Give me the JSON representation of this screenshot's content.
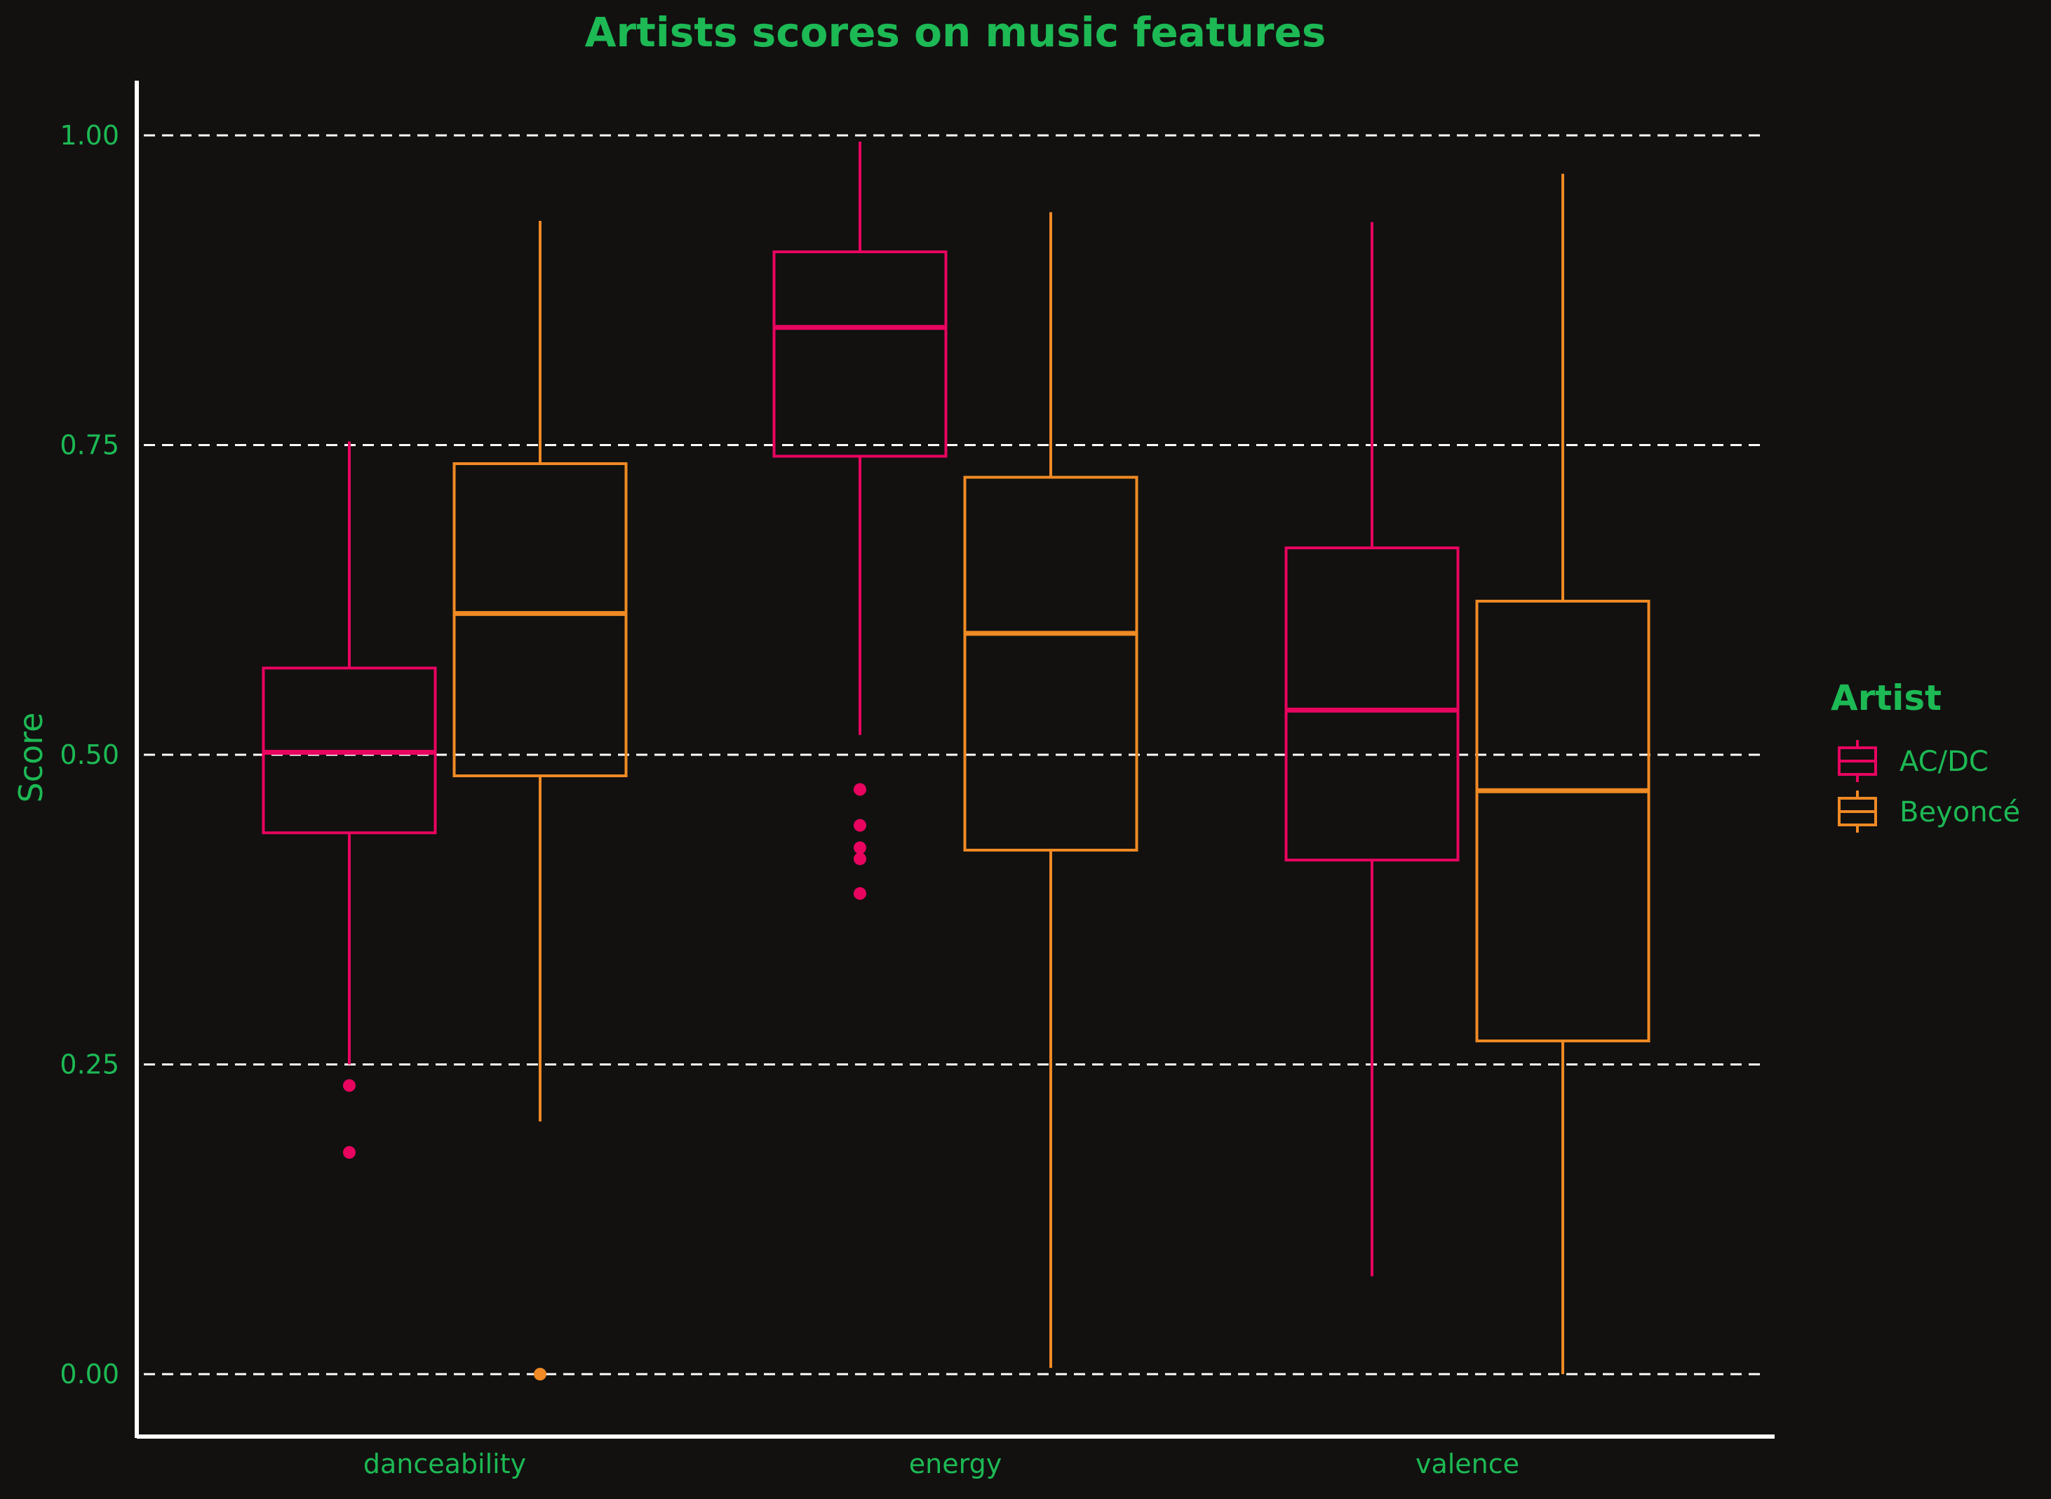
{
  "chart_data": {
    "type": "boxplot",
    "title": "Artists scores on music features",
    "xlabel": "",
    "ylabel": "Score",
    "ylim": [
      -0.05,
      1.04
    ],
    "yticks": [
      0.0,
      0.25,
      0.5,
      0.75,
      1.0
    ],
    "ytick_labels": [
      "0.00",
      "0.25",
      "0.50",
      "0.75",
      "1.00"
    ],
    "categories": [
      "danceability",
      "energy",
      "valence"
    ],
    "grid": "horizontal dashed",
    "legend": {
      "title": "Artist",
      "position": "right"
    },
    "series": [
      {
        "name": "AC/DC",
        "color": "#e8045f",
        "boxes": [
          {
            "whisker_low": 0.25,
            "q1": 0.437,
            "median": 0.502,
            "q3": 0.57,
            "whisker_high": 0.753,
            "outliers": [
              0.233,
              0.179
            ]
          },
          {
            "whisker_low": 0.516,
            "q1": 0.741,
            "median": 0.845,
            "q3": 0.906,
            "whisker_high": 0.995,
            "outliers": [
              0.472,
              0.443,
              0.425,
              0.416,
              0.388
            ]
          },
          {
            "whisker_low": 0.079,
            "q1": 0.415,
            "median": 0.536,
            "q3": 0.667,
            "whisker_high": 0.93,
            "outliers": []
          }
        ]
      },
      {
        "name": "Beyoncé",
        "color": "#f08a24",
        "boxes": [
          {
            "whisker_low": 0.204,
            "q1": 0.483,
            "median": 0.614,
            "q3": 0.735,
            "whisker_high": 0.931,
            "outliers": [
              0.0
            ]
          },
          {
            "whisker_low": 0.005,
            "q1": 0.423,
            "median": 0.598,
            "q3": 0.724,
            "whisker_high": 0.938,
            "outliers": []
          },
          {
            "whisker_low": 0.0,
            "q1": 0.269,
            "median": 0.471,
            "q3": 0.624,
            "whisker_high": 0.969,
            "outliers": []
          }
        ]
      }
    ]
  },
  "colors": {
    "background": "#121110",
    "text": "#1db954",
    "axis": "#ffffff",
    "grid": "#ffffff"
  }
}
